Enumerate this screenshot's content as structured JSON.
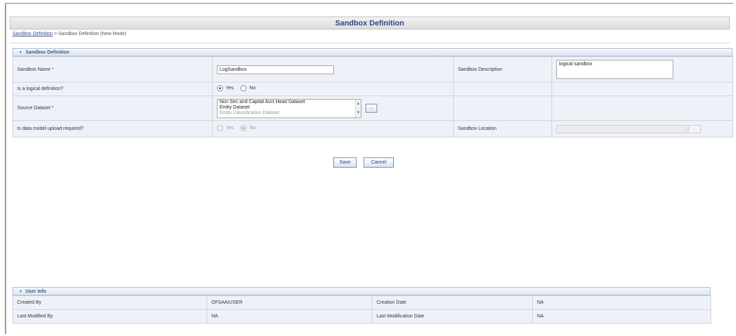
{
  "page": {
    "title": "Sandbox Definition",
    "breadcrumb": {
      "link": "Sandbox Definition",
      "separator": ">",
      "current": "Sandbox Definition (New Mode)"
    }
  },
  "definition_section": {
    "header": "Sandbox Definition",
    "sandbox_name": {
      "label": "Sandbox Name",
      "required": "*",
      "value": "LogSandbox"
    },
    "sandbox_description": {
      "label": "Sandbox Description",
      "value": "logical sandbox"
    },
    "logical_definition": {
      "label": "Is a logical definition?",
      "yes_label": "Yes",
      "no_label": "No",
      "selected": "Yes"
    },
    "source_dataset": {
      "label": "Source Dataset",
      "required": "*",
      "options": [
        "Non Sec and Capital Acct Head Dataset",
        "Entity Dataset",
        "Entity Classification Dataset"
      ],
      "browse_label": "..."
    },
    "data_model_upload": {
      "label": "Is data model upload required?",
      "yes_label": "Yes",
      "no_label": "No",
      "selected": "No"
    },
    "sandbox_location": {
      "label": "Sandbox Location",
      "value": "",
      "browse_label": "..."
    }
  },
  "actions": {
    "save_label": "Save",
    "cancel_label": "Cancel"
  },
  "user_info": {
    "header": "User Info",
    "created_by_label": "Created By",
    "created_by_value": "OFSAAIUSER",
    "creation_date_label": "Creation Date",
    "creation_date_value": "NA",
    "last_modified_by_label": "Last Modified By",
    "last_modified_by_value": "NA",
    "last_modification_date_label": "Last Modification Date",
    "last_modification_date_value": "NA"
  },
  "colors": {
    "title_text": "#264a8a",
    "section_header_text": "#355792",
    "row_background": "#eef2f8",
    "required_marker": "#d00000"
  }
}
